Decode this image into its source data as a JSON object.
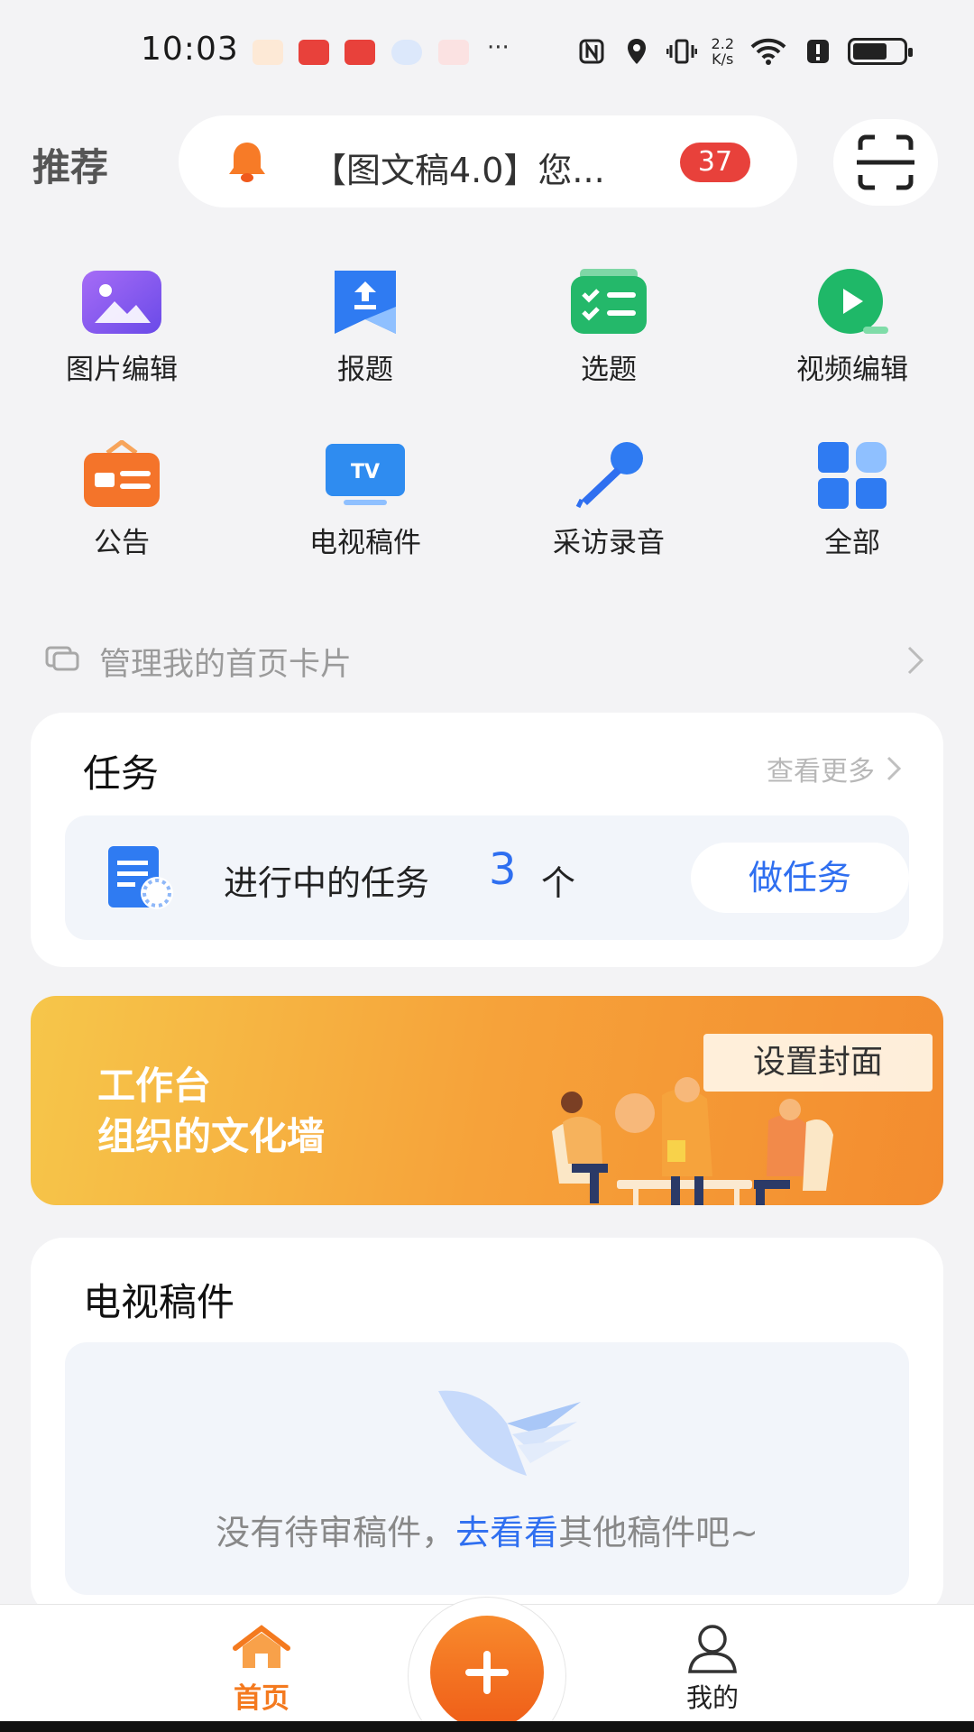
{
  "status_bar": {
    "time": "10:03",
    "more": "···",
    "net_speed_value": "2.2",
    "net_speed_unit": "K/s",
    "battery_level": 0.68
  },
  "header": {
    "title": "推荐",
    "notice_text": "【图文稿4.0】您...",
    "notice_badge": "37"
  },
  "quick_actions": [
    {
      "label": "图片编辑",
      "icon": "image-edit-icon"
    },
    {
      "label": "报题",
      "icon": "report-topic-icon"
    },
    {
      "label": "选题",
      "icon": "select-topic-icon"
    },
    {
      "label": "视频编辑",
      "icon": "video-edit-icon"
    },
    {
      "label": "公告",
      "icon": "announcement-icon"
    },
    {
      "label": "电视稿件",
      "icon": "tv-icon"
    },
    {
      "label": "采访录音",
      "icon": "microphone-icon"
    },
    {
      "label": "全部",
      "icon": "all-apps-icon"
    }
  ],
  "manage_cards": {
    "label": "管理我的首页卡片"
  },
  "task_card": {
    "title": "任务",
    "see_more": "查看更多",
    "in_progress_label": "进行中的任务",
    "count": "3",
    "unit": "个",
    "action": "做任务"
  },
  "banner": {
    "line1": "工作台",
    "line2": "组织的文化墙",
    "cover_button": "设置封面"
  },
  "tv_card": {
    "title": "电视稿件",
    "empty_prefix": "没有待审稿件，",
    "empty_link": "去看看",
    "empty_suffix": "其他稿件吧~"
  },
  "bottom_nav": {
    "home": "首页",
    "me": "我的"
  },
  "colors": {
    "accent_orange": "#f47a1f",
    "link_blue": "#2f6ff0",
    "badge_red": "#e8413b"
  }
}
